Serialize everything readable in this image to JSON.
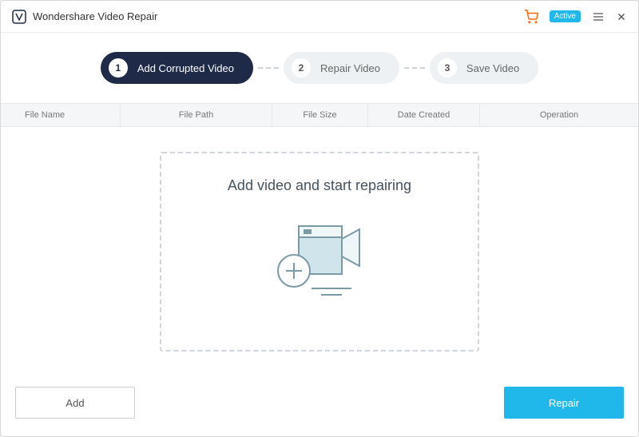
{
  "app": {
    "title": "Wondershare Video Repair",
    "active_badge": "Active"
  },
  "steps": [
    {
      "num": "1",
      "label": "Add Corrupted Video",
      "active": true
    },
    {
      "num": "2",
      "label": "Repair Video",
      "active": false
    },
    {
      "num": "3",
      "label": "Save Video",
      "active": false
    }
  ],
  "table": {
    "headers": {
      "filename": "File Name",
      "filepath": "File Path",
      "filesize": "File Size",
      "datecreated": "Date Created",
      "operation": "Operation"
    }
  },
  "dropzone": {
    "text": "Add video and start repairing"
  },
  "footer": {
    "add": "Add",
    "repair": "Repair"
  }
}
